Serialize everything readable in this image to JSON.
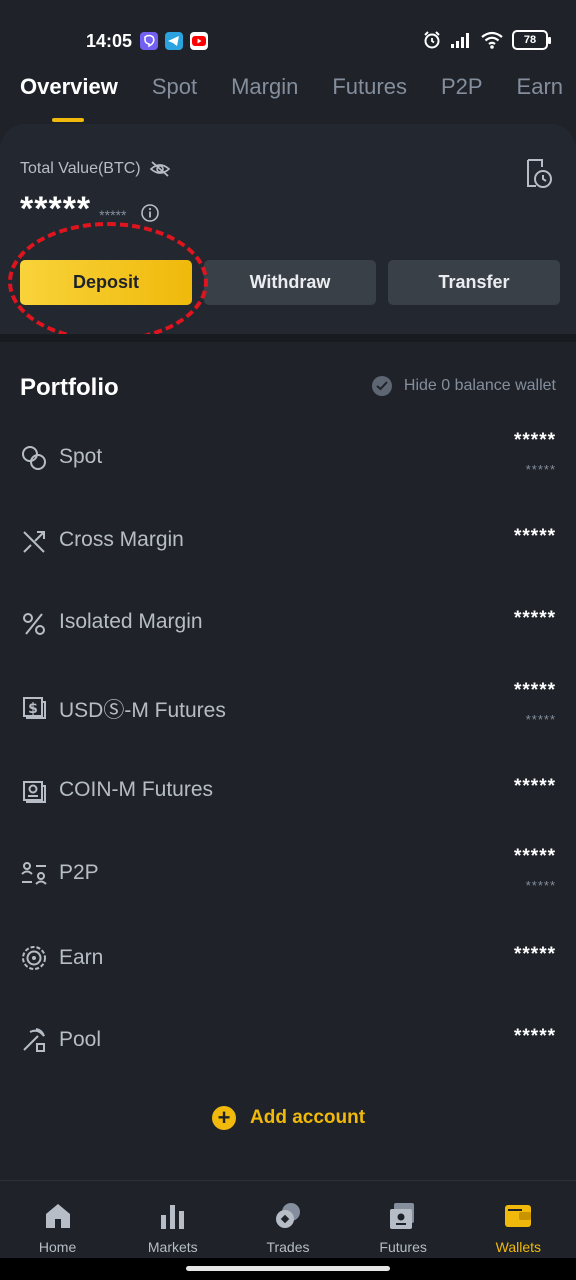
{
  "status_bar": {
    "time": "14:05",
    "apps": [
      "viber-icon",
      "telegram-icon",
      "youtube-icon"
    ],
    "battery": "78",
    "indicators": [
      "alarm-icon",
      "signal-icon",
      "wifi-icon"
    ]
  },
  "tabs": [
    "Overview",
    "Spot",
    "Margin",
    "Futures",
    "P2P",
    "Earn"
  ],
  "active_tab": "Overview",
  "overview": {
    "total_label": "Total Value(BTC)",
    "total_value": "*****",
    "total_sub": "*****",
    "buttons": {
      "deposit": "Deposit",
      "withdraw": "Withdraw",
      "transfer": "Transfer"
    }
  },
  "portfolio": {
    "title": "Portfolio",
    "hide_label": "Hide 0 balance wallet",
    "rows": [
      {
        "label": "Spot",
        "icon": "spot-icon",
        "value": "*****",
        "sub": "*****"
      },
      {
        "label": "Cross Margin",
        "icon": "cross-margin-icon",
        "value": "*****",
        "sub": ""
      },
      {
        "label": "Isolated Margin",
        "icon": "isolated-margin-icon",
        "value": "*****",
        "sub": ""
      },
      {
        "label": "USDⓈ-M Futures",
        "icon": "usds-futures-icon",
        "value": "*****",
        "sub": "*****"
      },
      {
        "label": "COIN-M Futures",
        "icon": "coin-futures-icon",
        "value": "*****",
        "sub": ""
      },
      {
        "label": "P2P",
        "icon": "p2p-icon",
        "value": "*****",
        "sub": "*****"
      },
      {
        "label": "Earn",
        "icon": "earn-icon",
        "value": "*****",
        "sub": ""
      },
      {
        "label": "Pool",
        "icon": "pool-icon",
        "value": "*****",
        "sub": ""
      }
    ],
    "add_account": "Add account"
  },
  "bottom_nav": [
    {
      "label": "Home",
      "icon": "home-icon"
    },
    {
      "label": "Markets",
      "icon": "markets-icon"
    },
    {
      "label": "Trades",
      "icon": "trades-icon"
    },
    {
      "label": "Futures",
      "icon": "futures-icon"
    },
    {
      "label": "Wallets",
      "icon": "wallets-icon",
      "active": true
    }
  ],
  "colors": {
    "background": "#1f2329",
    "accent": "#f0b90b",
    "highlight": "#e0141e"
  }
}
